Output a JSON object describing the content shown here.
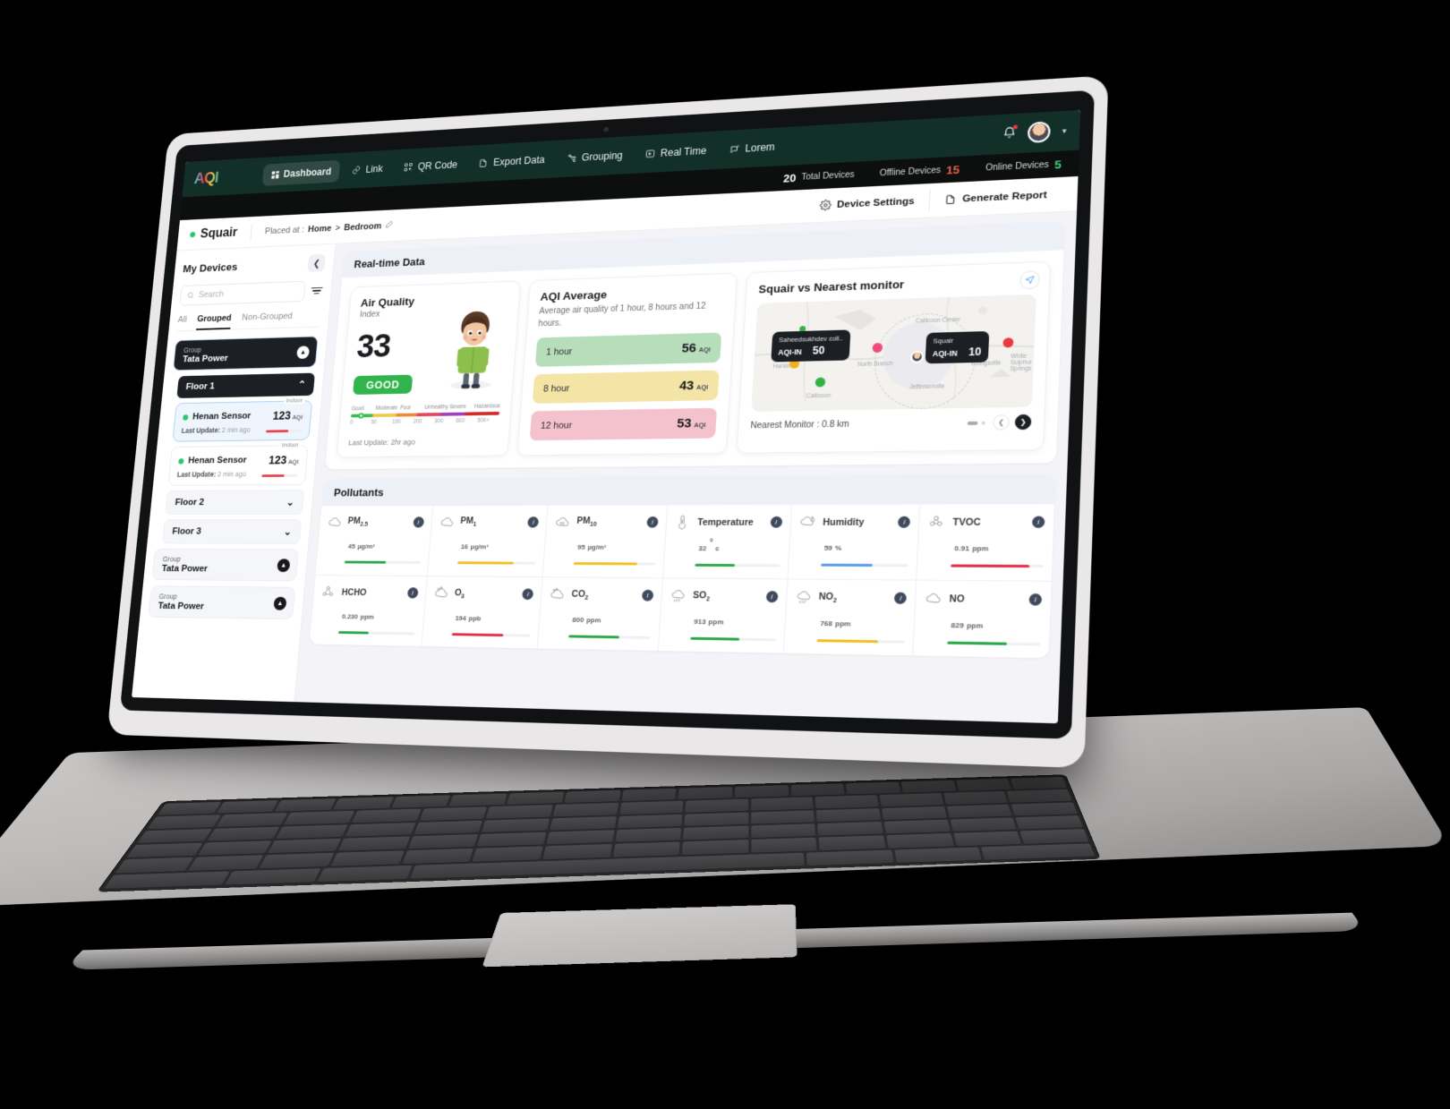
{
  "brand": {
    "logo": "AQI"
  },
  "topnav": {
    "items": [
      {
        "label": "Dashboard",
        "icon": "grid-icon",
        "active": true
      },
      {
        "label": "Link",
        "icon": "link-icon",
        "active": false
      },
      {
        "label": "QR Code",
        "icon": "qr-code-icon",
        "active": false
      },
      {
        "label": "Export Data",
        "icon": "export-icon",
        "active": false
      },
      {
        "label": "Grouping",
        "icon": "grouping-icon",
        "active": false
      },
      {
        "label": "Real Time",
        "icon": "real-time-icon",
        "active": false
      },
      {
        "label": "Lorem",
        "icon": "lorem-icon",
        "active": false
      }
    ]
  },
  "statbar": {
    "total_value": "20",
    "total_label": "Total Devices",
    "offline_label": "Offline Devices",
    "offline_value": "15",
    "online_label": "Online Devices",
    "online_value": "5"
  },
  "pagehead": {
    "device_name": "Squair",
    "placed_label": "Placed at :",
    "breadcrumb_1": "Home",
    "breadcrumb_sep": ">",
    "breadcrumb_2": "Bedroom",
    "device_settings": "Device Settings",
    "generate_report": "Generate Report"
  },
  "sidebar": {
    "title": "My Devices",
    "search_placeholder": "Search",
    "tabs": [
      {
        "label": "All",
        "active": false
      },
      {
        "label": "Grouped",
        "active": true
      },
      {
        "label": "Non-Grouped",
        "active": false
      }
    ],
    "group_label": "Group",
    "groups": [
      {
        "name": "Tata Power",
        "expanded": true
      },
      {
        "name": "Tata Power",
        "expanded": false
      },
      {
        "name": "Tata Power",
        "expanded": false
      }
    ],
    "floors": [
      {
        "label": "Floor 1",
        "expanded": true
      },
      {
        "label": "Floor 2",
        "expanded": false
      },
      {
        "label": "Floor 3",
        "expanded": false
      }
    ],
    "devices": [
      {
        "name": "Henan Sensor",
        "aqi": "123",
        "aqi_unit": "AQI",
        "tag": "Indoor",
        "update_label": "Last Update:",
        "update_value": "2 min ago",
        "selected": true
      },
      {
        "name": "Henan Sensor",
        "aqi": "123",
        "aqi_unit": "AQI",
        "tag": "Indoor",
        "update_label": "Last Update:",
        "update_value": "2 min ago",
        "selected": false
      }
    ]
  },
  "realtime": {
    "section_title": "Real-time Data",
    "air_quality": {
      "title": "Air Quality",
      "subtitle": "Index",
      "value": "33",
      "badge": "GOOD",
      "badge_color": "#31b44b",
      "scale_labels": [
        "Good",
        "Moderate",
        "Poor",
        "Unhealthy",
        "Severe",
        "Hazardous"
      ],
      "scale_ticks": [
        "0",
        "50",
        "100",
        "200",
        "300",
        "600",
        "500+"
      ],
      "update": "Last Update: 2hr ago"
    },
    "aqi_average": {
      "title": "AQI Average",
      "description": "Average air quality of 1 hour, 8 hours and 12 hours.",
      "rows": [
        {
          "label": "1 hour",
          "value": "56",
          "unit": "AQI",
          "bg": "#b7debb"
        },
        {
          "label": "8 hour",
          "value": "43",
          "unit": "AQI",
          "bg": "#f4e4a6"
        },
        {
          "label": "12 hour",
          "value": "53",
          "unit": "AQI",
          "bg": "#f4c2cd"
        }
      ]
    },
    "map": {
      "title": "Squair vs Nearest monitor",
      "nearest_monitor": "Nearest Monitor : 0.8 km",
      "tooltip_a": {
        "name": "Saheedsukhdev coll..",
        "key": "AQI-IN",
        "value": "50"
      },
      "tooltip_b": {
        "name": "Squair",
        "key": "AQI-IN",
        "value": "10"
      },
      "place_labels": [
        "Callicoon Center",
        "North Branch",
        "Jeffersonville",
        "Youngsville",
        "White Sulphur Springs",
        "Hankins",
        "Callicoon"
      ]
    }
  },
  "pollutants": {
    "section_title": "Pollutants",
    "items": [
      {
        "name": "PM",
        "sub": "2.5",
        "value": "45",
        "unit": "µg/m³",
        "icon": "cloud-icon",
        "bar_color": "#2aa84a",
        "bar_pct": 55
      },
      {
        "name": "PM",
        "sub": "1",
        "value": "16",
        "unit": "µg/m³",
        "icon": "cloud-icon",
        "bar_color": "#f2c024",
        "bar_pct": 72
      },
      {
        "name": "PM",
        "sub": "10",
        "value": "95",
        "unit": "µg/m³",
        "icon": "cloud-dense-icon",
        "bar_color": "#f2c024",
        "bar_pct": 78
      },
      {
        "name": "Temperature",
        "sub": "",
        "value": "32",
        "unit": "c",
        "icon": "thermometer-icon",
        "bar_color": "#2aa84a",
        "bar_pct": 48,
        "degree": true
      },
      {
        "name": "Humidity",
        "sub": "",
        "value": "59",
        "unit": "%",
        "icon": "humidity-icon",
        "bar_color": "#5b9bf0",
        "bar_pct": 60
      },
      {
        "name": "TVOC",
        "sub": "",
        "value": "0.91",
        "unit": "ppm",
        "icon": "molecule-icon",
        "bar_color": "#e0304a",
        "bar_pct": 85
      },
      {
        "name": "HCHO",
        "sub": "",
        "value": "0.230",
        "unit": "ppm",
        "icon": "hcho-icon",
        "bar_color": "#2aa84a",
        "bar_pct": 40
      },
      {
        "name": "O",
        "sub": "3",
        "value": "194",
        "unit": "ppb",
        "icon": "ozone-icon",
        "bar_color": "#e0304a",
        "bar_pct": 66
      },
      {
        "name": "CO",
        "sub": "2",
        "value": "800",
        "unit": "ppm",
        "icon": "co2-icon",
        "bar_color": "#2aa84a",
        "bar_pct": 62
      },
      {
        "name": "SO",
        "sub": "2",
        "value": "913",
        "unit": "ppm",
        "icon": "so2-icon",
        "bar_color": "#2aa84a",
        "bar_pct": 58
      },
      {
        "name": "NO",
        "sub": "2",
        "value": "768",
        "unit": "ppm",
        "icon": "no2-icon",
        "bar_color": "#f2c024",
        "bar_pct": 70
      },
      {
        "name": "NO",
        "sub": "",
        "value": "829",
        "unit": "ppm",
        "icon": "no-icon",
        "bar_color": "#2aa84a",
        "bar_pct": 64
      }
    ]
  }
}
